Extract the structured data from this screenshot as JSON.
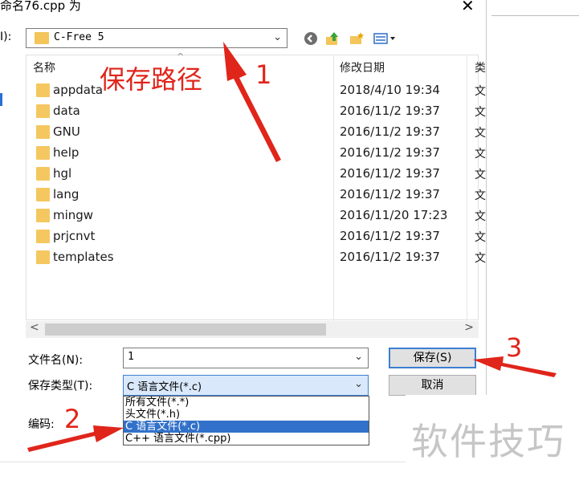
{
  "window": {
    "title_fragment": "命名76.cpp 为",
    "close_glyph": "✕"
  },
  "lookin": {
    "label": "I):",
    "value": "C-Free 5"
  },
  "toolbar": {
    "back_icon": "back-icon",
    "up_icon": "up-folder-icon",
    "newfolder_icon": "new-folder-icon",
    "view_icon": "view-menu-icon"
  },
  "filelist": {
    "col_name": "名称",
    "col_date": "修改日期",
    "col_type": "类",
    "rows": [
      {
        "name": "appdata",
        "date": "2018/4/10 19:34",
        "type": "文"
      },
      {
        "name": "data",
        "date": "2016/11/2 19:37",
        "type": "文"
      },
      {
        "name": "GNU",
        "date": "2016/11/2 19:37",
        "type": "文"
      },
      {
        "name": "help",
        "date": "2016/11/2 19:37",
        "type": "文"
      },
      {
        "name": "hgl",
        "date": "2016/11/2 19:37",
        "type": "文"
      },
      {
        "name": "lang",
        "date": "2016/11/2 19:37",
        "type": "文"
      },
      {
        "name": "mingw",
        "date": "2016/11/20 17:23",
        "type": "文"
      },
      {
        "name": "prjcnvt",
        "date": "2016/11/2 19:37",
        "type": "文"
      },
      {
        "name": "templates",
        "date": "2016/11/2 19:37",
        "type": "文"
      }
    ]
  },
  "filename": {
    "label": "文件名(N):",
    "value": "1"
  },
  "filetype": {
    "label": "保存类型(T):",
    "value": "C 语言文件(*.c)",
    "options": [
      "所有文件(*.*)",
      "头文件(*.h)",
      "C 语言文件(*.c)",
      "C++ 语言文件(*.cpp)"
    ],
    "selected_index": 2
  },
  "encoding": {
    "label": "编码:"
  },
  "buttons": {
    "save": "保存(S)",
    "cancel": "取消"
  },
  "annotations": {
    "path_label": "保存路径",
    "n1": "1",
    "n2": "2",
    "n3": "3",
    "color": "#e0251b"
  },
  "watermark": "软件技巧",
  "colors": {
    "accent": "#3c7fd1",
    "selection": "#3271c9",
    "folder": "#f5c760"
  }
}
